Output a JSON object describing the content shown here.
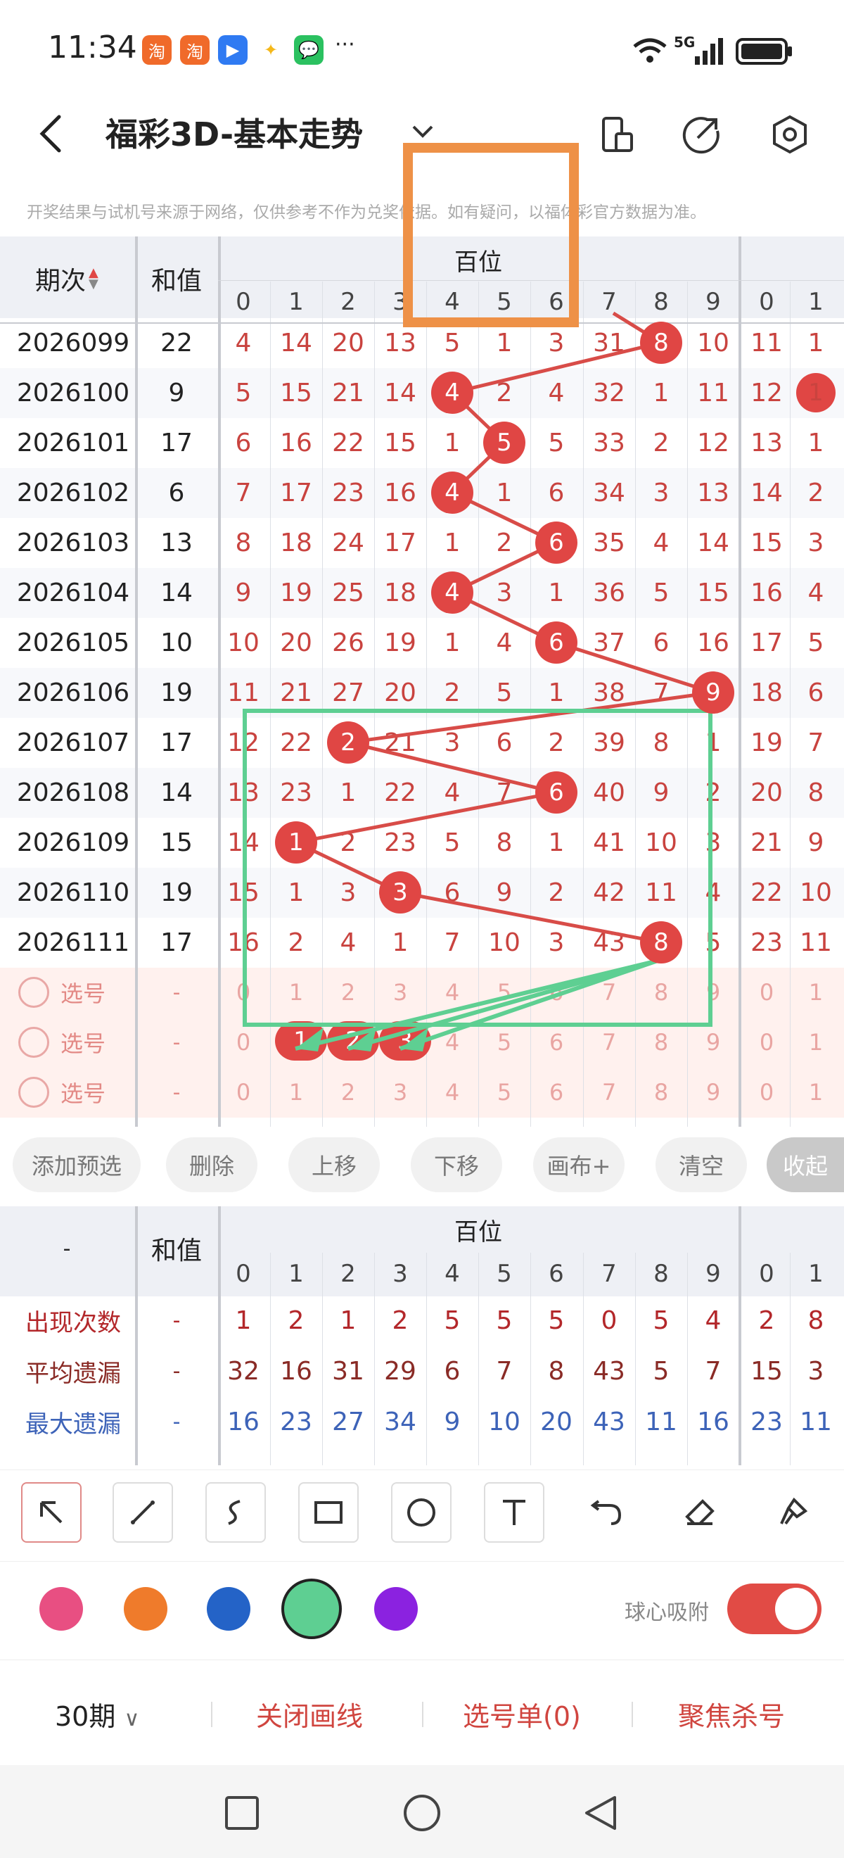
{
  "status": {
    "time": "11:34",
    "signal": "5G",
    "more": "···"
  },
  "header": {
    "title": "福彩3D-基本走势",
    "dropdown_icon": "chevron-down-icon"
  },
  "notice": "开奖结果与试机号来源于网络，仅供参考不作为兑奖依据。如有疑问，以福体彩官方数据为准。",
  "table": {
    "col_issue": "期次",
    "col_sum": "和值",
    "group_label": "百位",
    "digits": [
      "0",
      "1",
      "2",
      "3",
      "4",
      "5",
      "6",
      "7",
      "8",
      "9",
      "0",
      "1"
    ],
    "rows": [
      {
        "issue": "2026099",
        "sum": "22",
        "cells": [
          "4",
          "14",
          "20",
          "13",
          "5",
          "1",
          "3",
          "31",
          "8",
          "10",
          "11",
          "1"
        ],
        "hit": 8
      },
      {
        "issue": "2026100",
        "sum": "9",
        "cells": [
          "5",
          "15",
          "21",
          "14",
          "4",
          "2",
          "4",
          "32",
          "1",
          "11",
          "12",
          "1"
        ],
        "hit": 4
      },
      {
        "issue": "2026101",
        "sum": "17",
        "cells": [
          "6",
          "16",
          "22",
          "15",
          "1",
          "5",
          "5",
          "33",
          "2",
          "12",
          "13",
          "1"
        ],
        "hit": 5
      },
      {
        "issue": "2026102",
        "sum": "6",
        "cells": [
          "7",
          "17",
          "23",
          "16",
          "4",
          "1",
          "6",
          "34",
          "3",
          "13",
          "14",
          "2"
        ],
        "hit": 4
      },
      {
        "issue": "2026103",
        "sum": "13",
        "cells": [
          "8",
          "18",
          "24",
          "17",
          "1",
          "2",
          "6",
          "35",
          "4",
          "14",
          "15",
          "3"
        ],
        "hit": 6
      },
      {
        "issue": "2026104",
        "sum": "14",
        "cells": [
          "9",
          "19",
          "25",
          "18",
          "4",
          "3",
          "1",
          "36",
          "5",
          "15",
          "16",
          "4"
        ],
        "hit": 4
      },
      {
        "issue": "2026105",
        "sum": "10",
        "cells": [
          "10",
          "20",
          "26",
          "19",
          "1",
          "4",
          "6",
          "37",
          "6",
          "16",
          "17",
          "5"
        ],
        "hit": 6
      },
      {
        "issue": "2026106",
        "sum": "19",
        "cells": [
          "11",
          "21",
          "27",
          "20",
          "2",
          "5",
          "1",
          "38",
          "7",
          "9",
          "18",
          "6"
        ],
        "hit": 9
      },
      {
        "issue": "2026107",
        "sum": "17",
        "cells": [
          "12",
          "22",
          "2",
          "21",
          "3",
          "6",
          "2",
          "39",
          "8",
          "1",
          "19",
          "7"
        ],
        "hit": 2
      },
      {
        "issue": "2026108",
        "sum": "14",
        "cells": [
          "13",
          "23",
          "1",
          "22",
          "4",
          "7",
          "6",
          "40",
          "9",
          "2",
          "20",
          "8"
        ],
        "hit": 6
      },
      {
        "issue": "2026109",
        "sum": "15",
        "cells": [
          "14",
          "1",
          "2",
          "23",
          "5",
          "8",
          "1",
          "41",
          "10",
          "3",
          "21",
          "9"
        ],
        "hit": 1
      },
      {
        "issue": "2026110",
        "sum": "19",
        "cells": [
          "15",
          "1",
          "3",
          "3",
          "6",
          "9",
          "2",
          "42",
          "11",
          "4",
          "22",
          "10"
        ],
        "hit": 3
      },
      {
        "issue": "2026111",
        "sum": "17",
        "cells": [
          "16",
          "2",
          "4",
          "1",
          "7",
          "10",
          "3",
          "43",
          "8",
          "5",
          "23",
          "11"
        ],
        "hit": 8
      }
    ],
    "pick_label": "选号",
    "pick_sum": "-",
    "pick_digits": [
      "0",
      "1",
      "2",
      "3",
      "4",
      "5",
      "6",
      "7",
      "8",
      "9",
      "0",
      "1"
    ],
    "pick_selected": [
      1,
      2,
      3
    ]
  },
  "actions": [
    "添加预选",
    "删除",
    "上移",
    "下移",
    "画布+",
    "清空",
    "收起"
  ],
  "stats": {
    "col_first": "-",
    "col_sum": "和值",
    "group_label": "百位",
    "digits": [
      "0",
      "1",
      "2",
      "3",
      "4",
      "5",
      "6",
      "7",
      "8",
      "9",
      "0",
      "1"
    ],
    "rows": [
      {
        "label": "出现次数",
        "sum": "-",
        "values": [
          "1",
          "2",
          "1",
          "2",
          "5",
          "5",
          "5",
          "0",
          "5",
          "4",
          "2",
          "8"
        ],
        "color": "#b3272a"
      },
      {
        "label": "平均遗漏",
        "sum": "-",
        "values": [
          "32",
          "16",
          "31",
          "29",
          "6",
          "7",
          "8",
          "43",
          "5",
          "7",
          "15",
          "3"
        ],
        "color": "#8a2b26"
      },
      {
        "label": "最大遗漏",
        "sum": "-",
        "values": [
          "16",
          "23",
          "27",
          "34",
          "9",
          "10",
          "20",
          "43",
          "11",
          "16",
          "23",
          "11"
        ],
        "color": "#3d63b8"
      }
    ]
  },
  "tools": [
    "pointer-arrow-icon",
    "line-icon",
    "curve-icon",
    "rectangle-icon",
    "circle-icon",
    "text-icon",
    "undo-icon",
    "eraser-icon",
    "brush-icon"
  ],
  "colors": [
    "#e84f82",
    "#ef7b2b",
    "#2463c7",
    "#5ecf92",
    "#8b22e0"
  ],
  "snap": {
    "label": "球心吸附",
    "on": true
  },
  "bottom": {
    "period": "30期",
    "close_line": "关闭画线",
    "pick_list": "选号单(0)",
    "focus_kill": "聚焦杀号"
  }
}
